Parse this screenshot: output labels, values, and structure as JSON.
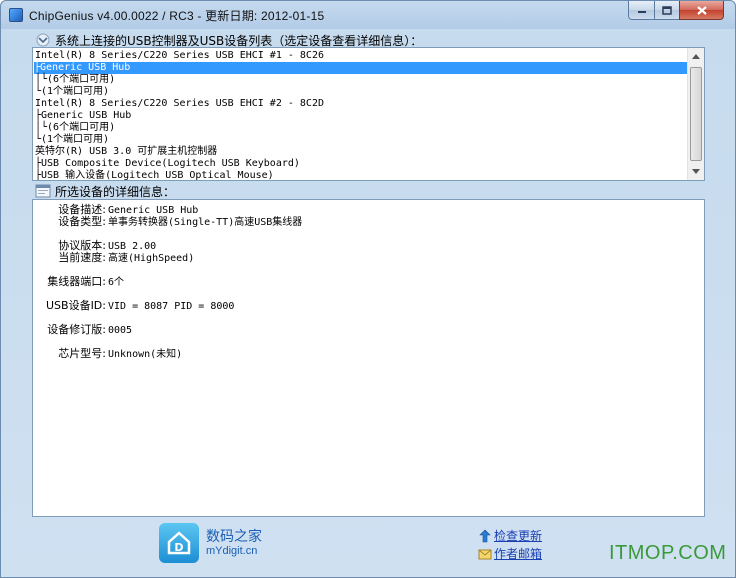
{
  "window": {
    "title": "ChipGenius v4.00.0022 / RC3 - 更新日期: 2012-01-15"
  },
  "device_list": {
    "header": "系统上连接的USB控制器及USB设备列表（选定设备查看详细信息）：",
    "rows": [
      {
        "text": "Intel(R) 8 Series/C220 Series USB EHCI #1 - 8C26",
        "selected": false
      },
      {
        "text": "├Generic USB Hub",
        "selected": true
      },
      {
        "text": "│└(6个端口可用)",
        "selected": false
      },
      {
        "text": "└(1个端口可用)",
        "selected": false
      },
      {
        "text": "Intel(R) 8 Series/C220 Series USB EHCI #2 - 8C2D",
        "selected": false
      },
      {
        "text": "├Generic USB Hub",
        "selected": false
      },
      {
        "text": "│└(6个端口可用)",
        "selected": false
      },
      {
        "text": "└(1个端口可用)",
        "selected": false
      },
      {
        "text": "英特尔(R) USB 3.0 可扩展主机控制器",
        "selected": false
      },
      {
        "text": "├USB Composite Device(Logitech USB Keyboard)",
        "selected": false
      },
      {
        "text": "├USB 输入设备(Logitech USB Optical Mouse)",
        "selected": false
      }
    ]
  },
  "details": {
    "header": "所选设备的详细信息：",
    "fields": [
      {
        "label": "设备描述:",
        "value": "Generic USB Hub"
      },
      {
        "label": "设备类型:",
        "value": "单事务转换器(Single-TT)高速USB集线器"
      },
      {
        "label": "协议版本:",
        "value": "USB 2.00"
      },
      {
        "label": "当前速度:",
        "value": "高速(HighSpeed)"
      },
      {
        "label": "集线器端口:",
        "value": "6个"
      },
      {
        "label": "USB设备ID:",
        "value": "VID = 8087 PID = 8000"
      },
      {
        "label": "设备修订版:",
        "value": "0005"
      },
      {
        "label": "芯片型号:",
        "value": "Unknown(未知)"
      }
    ]
  },
  "footer": {
    "brand_cn": "数码之家",
    "brand_en": "mYdigit.cn",
    "check_update": "检查更新",
    "author_email": "作者邮箱",
    "watermark": "ITMOP.COM"
  }
}
